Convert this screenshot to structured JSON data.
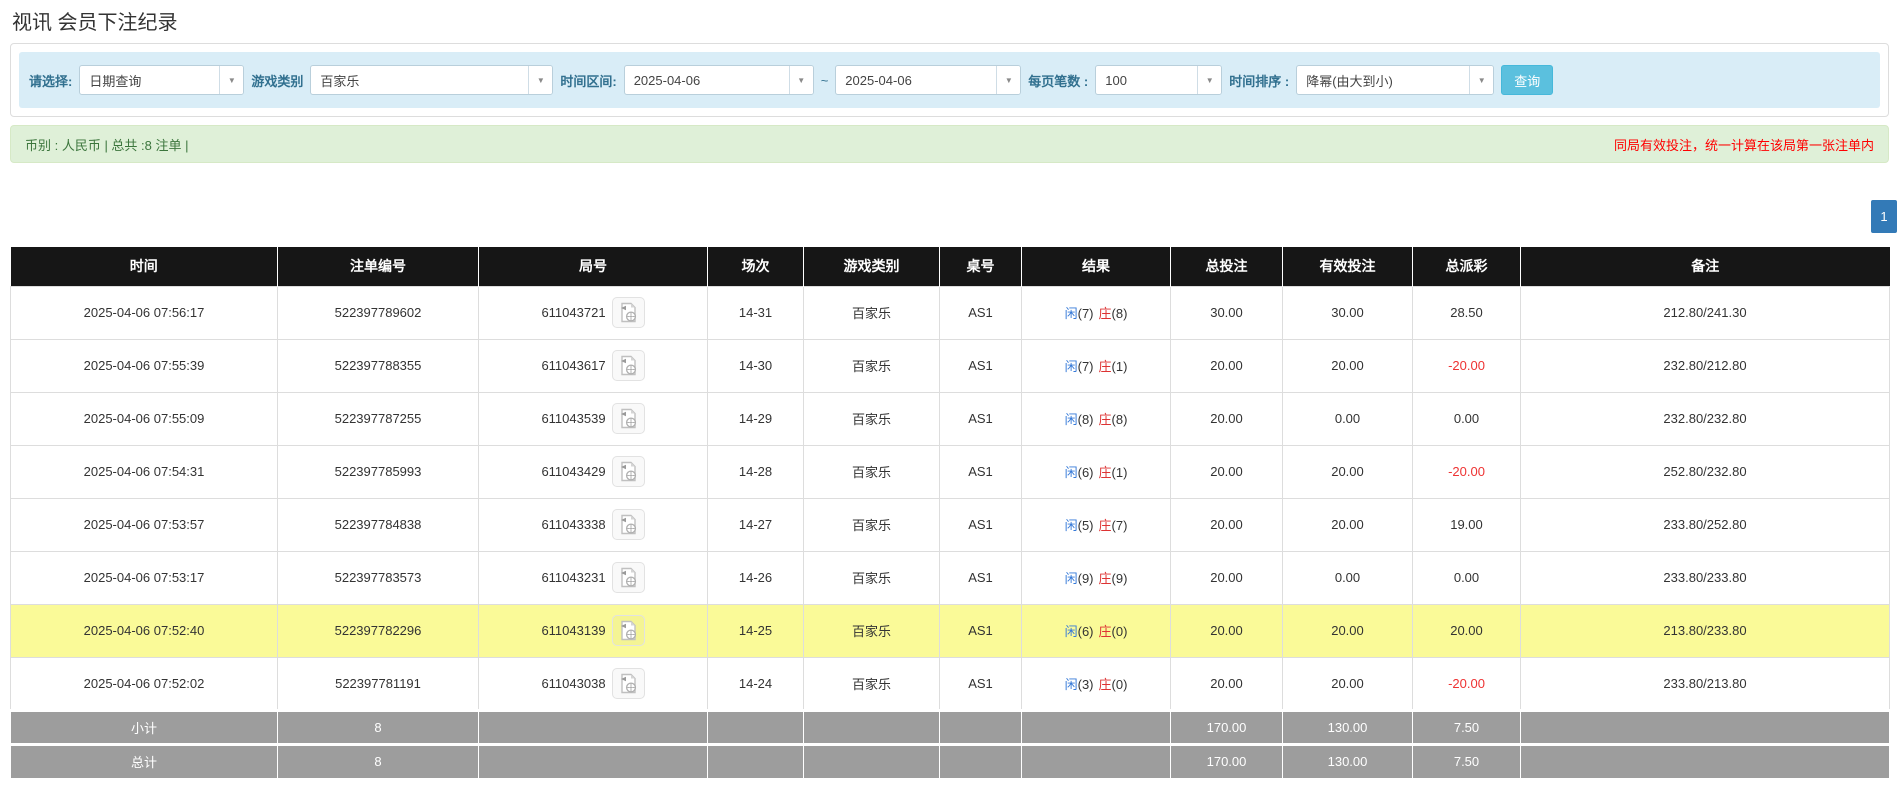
{
  "page_title": "视讯 会员下注纪录",
  "filters": {
    "select_label": "请选择:",
    "select_value": "日期查询",
    "game_type_label": "游戏类别",
    "game_type_value": "百家乐",
    "time_range_label": "时间区间:",
    "date_from": "2025-04-06",
    "range_separator": "~",
    "date_to": "2025-04-06",
    "page_size_label": "每页笔数 :",
    "page_size_value": "100",
    "sort_label": "时间排序 :",
    "sort_value": "降幂(由大到小)",
    "search_button_label": "查询"
  },
  "summary_bar": {
    "left_text": "币别 : 人民币 | 总共 :8 注单 |",
    "right_text": "同局有效投注，统一计算在该局第一张注单内"
  },
  "pagination": {
    "current_page": "1"
  },
  "icons": {
    "dropdown_arrow": "▼"
  },
  "colors": {
    "accent_blue": "#3579d8",
    "pagination_blue": "#337ab7",
    "negative_red": "#ee3333",
    "banker_red": "#dd3333",
    "header_bg": "#161616",
    "highlight_yellow": "#fafa98",
    "summary_gray": "#9d9d9d",
    "alert_red": "#ff0000",
    "green_bg": "#dff0d8",
    "green_text": "#3c763d",
    "filter_bg": "#d9edf7",
    "filter_label": "#31708f",
    "button_blue": "#5bc0de"
  },
  "table": {
    "headers": [
      "时间",
      "注单编号",
      "局号",
      "场次",
      "游戏类别",
      "桌号",
      "结果",
      "总投注",
      "有效投注",
      "总派彩",
      "备注"
    ],
    "rows": [
      {
        "time": "2025-04-06 07:56:17",
        "bet_id": "522397789602",
        "round_id": "611043721",
        "session": "14-31",
        "game": "百家乐",
        "table_no": "AS1",
        "result": {
          "player_label": "闲",
          "player_score": "(7)",
          "banker_label": "庄",
          "banker_score": "(8)"
        },
        "total_bet": "30.00",
        "valid_bet": "30.00",
        "payout": "28.50",
        "remark": "212.80/241.30",
        "highlight": false
      },
      {
        "time": "2025-04-06 07:55:39",
        "bet_id": "522397788355",
        "round_id": "611043617",
        "session": "14-30",
        "game": "百家乐",
        "table_no": "AS1",
        "result": {
          "player_label": "闲",
          "player_score": "(7)",
          "banker_label": "庄",
          "banker_score": "(1)"
        },
        "total_bet": "20.00",
        "valid_bet": "20.00",
        "payout": "-20.00",
        "remark": "232.80/212.80",
        "highlight": false
      },
      {
        "time": "2025-04-06 07:55:09",
        "bet_id": "522397787255",
        "round_id": "611043539",
        "session": "14-29",
        "game": "百家乐",
        "table_no": "AS1",
        "result": {
          "player_label": "闲",
          "player_score": "(8)",
          "banker_label": "庄",
          "banker_score": "(8)"
        },
        "total_bet": "20.00",
        "valid_bet": "0.00",
        "payout": "0.00",
        "remark": "232.80/232.80",
        "highlight": false
      },
      {
        "time": "2025-04-06 07:54:31",
        "bet_id": "522397785993",
        "round_id": "611043429",
        "session": "14-28",
        "game": "百家乐",
        "table_no": "AS1",
        "result": {
          "player_label": "闲",
          "player_score": "(6)",
          "banker_label": "庄",
          "banker_score": "(1)"
        },
        "total_bet": "20.00",
        "valid_bet": "20.00",
        "payout": "-20.00",
        "remark": "252.80/232.80",
        "highlight": false
      },
      {
        "time": "2025-04-06 07:53:57",
        "bet_id": "522397784838",
        "round_id": "611043338",
        "session": "14-27",
        "game": "百家乐",
        "table_no": "AS1",
        "result": {
          "player_label": "闲",
          "player_score": "(5)",
          "banker_label": "庄",
          "banker_score": "(7)"
        },
        "total_bet": "20.00",
        "valid_bet": "20.00",
        "payout": "19.00",
        "remark": "233.80/252.80",
        "highlight": false
      },
      {
        "time": "2025-04-06 07:53:17",
        "bet_id": "522397783573",
        "round_id": "611043231",
        "session": "14-26",
        "game": "百家乐",
        "table_no": "AS1",
        "result": {
          "player_label": "闲",
          "player_score": "(9)",
          "banker_label": "庄",
          "banker_score": "(9)"
        },
        "total_bet": "20.00",
        "valid_bet": "0.00",
        "payout": "0.00",
        "remark": "233.80/233.80",
        "highlight": false
      },
      {
        "time": "2025-04-06 07:52:40",
        "bet_id": "522397782296",
        "round_id": "611043139",
        "session": "14-25",
        "game": "百家乐",
        "table_no": "AS1",
        "result": {
          "player_label": "闲",
          "player_score": "(6)",
          "banker_label": "庄",
          "banker_score": "(0)"
        },
        "total_bet": "20.00",
        "valid_bet": "20.00",
        "payout": "20.00",
        "remark": "213.80/233.80",
        "highlight": true
      },
      {
        "time": "2025-04-06 07:52:02",
        "bet_id": "522397781191",
        "round_id": "611043038",
        "session": "14-24",
        "game": "百家乐",
        "table_no": "AS1",
        "result": {
          "player_label": "闲",
          "player_score": "(3)",
          "banker_label": "庄",
          "banker_score": "(0)"
        },
        "total_bet": "20.00",
        "valid_bet": "20.00",
        "payout": "-20.00",
        "remark": "233.80/213.80",
        "highlight": false
      }
    ],
    "subtotal": {
      "label": "小计",
      "count": "8",
      "total_bet": "170.00",
      "valid_bet": "130.00",
      "payout": "7.50"
    },
    "total": {
      "label": "总计",
      "count": "8",
      "total_bet": "170.00",
      "valid_bet": "130.00",
      "payout": "7.50"
    }
  }
}
